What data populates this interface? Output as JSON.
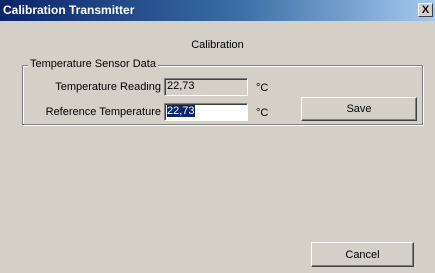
{
  "window": {
    "title": "Calibration Transmitter",
    "close_glyph": "X"
  },
  "header": {
    "label": "Calibration"
  },
  "group": {
    "legend": "Temperature Sensor Data",
    "reading_label": "Temperature Reading",
    "reading_value": "22,73",
    "reading_unit": "°C",
    "reference_label": "Reference Temperature",
    "reference_value": "22,73",
    "reference_unit": "°C"
  },
  "buttons": {
    "save": "Save",
    "cancel": "Cancel"
  }
}
